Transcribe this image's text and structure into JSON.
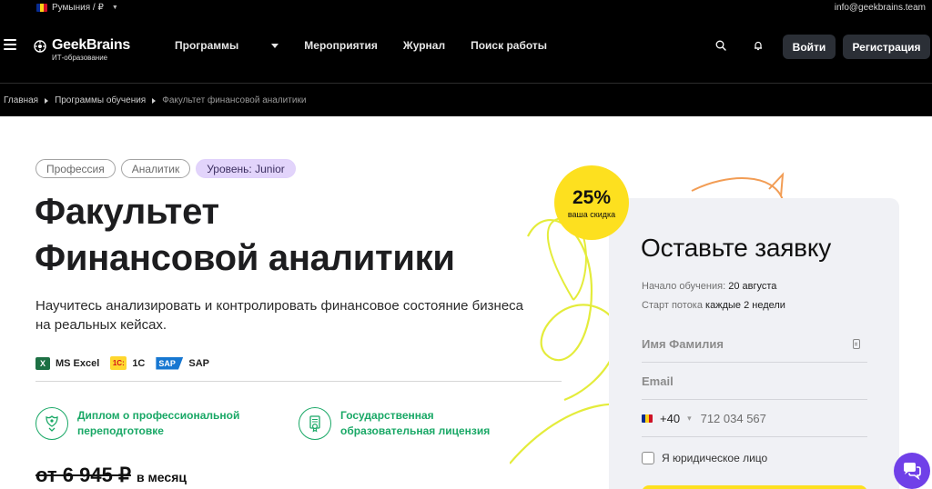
{
  "topbar": {
    "location": "Румыния / ₽",
    "email": "info@geekbrains.team",
    "flag_colors": [
      "#0a2c8f",
      "#fcd116",
      "#ce1126"
    ]
  },
  "header": {
    "logo_name": "GeekBrains",
    "logo_sub": "ИТ-образование",
    "nav": [
      "Программы",
      "Мероприятия",
      "Журнал",
      "Поиск работы"
    ],
    "login_label": "Войти",
    "register_label": "Регистрация",
    "icons": [
      "menu-icon",
      "search-icon",
      "bell-icon"
    ]
  },
  "breadcrumbs": [
    "Главная",
    "Программы обучения",
    "Факультет финансовой аналитики"
  ],
  "main": {
    "tags": [
      "Профессия",
      "Аналитик",
      "Уровень: Junior"
    ],
    "title_line1": "Факультет",
    "title_line2": "Финансовой аналитики",
    "description": "Научитесь анализировать и контролировать финансовое состояние бизнеса на реальных кейсах.",
    "tools": [
      {
        "label": "MS Excel",
        "icon_text": "X"
      },
      {
        "label": "1C",
        "icon_text": "1С:"
      },
      {
        "label": "SAP",
        "icon_text": "SAP"
      }
    ],
    "features": [
      {
        "line1": "Диплом о профессиональной",
        "line2": "переподготовке"
      },
      {
        "line1": "Государственная",
        "line2": "образовательная лицензия"
      }
    ],
    "price_old": "от 6 945 ₽",
    "price_period": "в месяц"
  },
  "badge": {
    "percent": "25%",
    "label": "ваша скидка"
  },
  "form": {
    "title": "Оставьте заявку",
    "start_label": "Начало обучения:",
    "start_value": "20 августа",
    "stream_label": "Старт потока",
    "stream_value": "каждые 2 недели",
    "name_placeholder": "Имя Фамилия",
    "email_placeholder": "Email",
    "phone_code": "+40",
    "phone_placeholder": "712 034 567",
    "legal_checkbox_label": "Я юридическое лицо"
  },
  "colors": {
    "accent_yellow": "#fde01f",
    "accent_green": "#19a866",
    "level_tag_bg": "#e2d4fb",
    "chat_purple": "#7040e8",
    "button_dark": "#2b2f36"
  }
}
